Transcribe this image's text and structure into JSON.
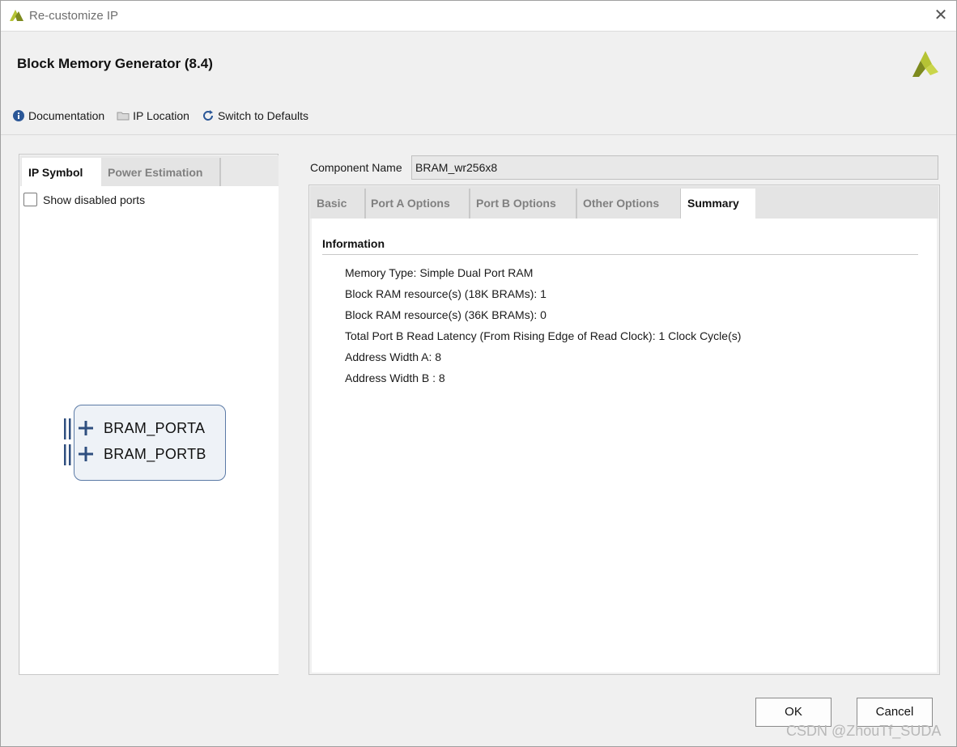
{
  "window": {
    "title": "Re-customize IP",
    "close_glyph": "✕",
    "app_icon": "xilinx-vivado-icon"
  },
  "header": {
    "heading": "Block Memory Generator (8.4)",
    "logo": "xilinx-logo",
    "toolbar": [
      {
        "label": "Documentation",
        "icon": "info-icon"
      },
      {
        "label": "IP Location",
        "icon": "folder-icon"
      },
      {
        "label": "Switch to Defaults",
        "icon": "refresh-icon"
      }
    ]
  },
  "left_panel": {
    "tabs": [
      {
        "label": "IP Symbol",
        "active": true
      },
      {
        "label": "Power Estimation",
        "active": false
      }
    ],
    "show_disabled_ports": {
      "label": "Show disabled ports",
      "checked": false
    },
    "ports": [
      {
        "label": "BRAM_PORTA"
      },
      {
        "label": "BRAM_PORTB"
      }
    ]
  },
  "component": {
    "label": "Component Name",
    "value": "BRAM_wr256x8"
  },
  "right_panel": {
    "tabs": [
      {
        "label": "Basic",
        "active": false
      },
      {
        "label": "Port A Options",
        "active": false
      },
      {
        "label": "Port B Options",
        "active": false
      },
      {
        "label": "Other Options",
        "active": false
      },
      {
        "label": "Summary",
        "active": true
      }
    ],
    "section_title": "Information",
    "lines": [
      "Memory Type: Simple Dual Port RAM",
      "Block RAM resource(s) (18K BRAMs): 1",
      "Block RAM resource(s) (36K BRAMs): 0",
      "Total Port B Read Latency (From Rising Edge of Read Clock): 1 Clock Cycle(s)",
      "Address Width A: 8",
      "Address Width B : 8"
    ]
  },
  "buttons": {
    "ok": "OK",
    "cancel": "Cancel"
  },
  "watermark": "CSDN @ZhouTf_SUDA",
  "colors": {
    "accent_logo": "#b5c334",
    "logo_dark": "#7d8a1e",
    "symbol_border": "#5b7aa6",
    "symbol_fill": "#eef2f7",
    "port_glyph": "#2f4f7f"
  }
}
